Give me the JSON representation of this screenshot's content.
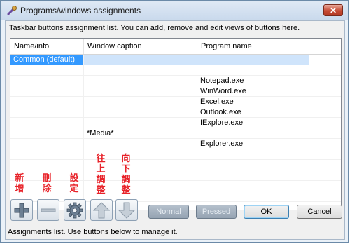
{
  "window": {
    "title": "Programs/windows assignments",
    "close_label": "✕"
  },
  "description": "Taskbar buttons assignment list. You can add, remove and edit views of buttons here.",
  "list": {
    "columns": [
      "Name/info",
      "Window caption",
      "Program name"
    ],
    "rows": [
      [
        "Common (default)",
        "",
        ""
      ],
      [
        "",
        "",
        ""
      ],
      [
        "",
        "",
        "Notepad.exe"
      ],
      [
        "",
        "",
        "WinWord.exe"
      ],
      [
        "",
        "",
        "Excel.exe"
      ],
      [
        "",
        "",
        "Outlook.exe"
      ],
      [
        "",
        "",
        "IExplore.exe"
      ],
      [
        "",
        "*Media*",
        ""
      ],
      [
        "",
        "",
        "Explorer.exe"
      ],
      [
        "",
        "",
        ""
      ],
      [
        "",
        "",
        ""
      ],
      [
        "",
        "",
        ""
      ],
      [
        "",
        "",
        ""
      ],
      [
        "",
        "",
        ""
      ]
    ]
  },
  "annotations": {
    "add": "新增",
    "remove": "刪除",
    "settings": "設定",
    "move_up": "往上調整",
    "move_down": "向下調整",
    "color": "#e8232a"
  },
  "toolbar": {
    "add_icon": "plus-icon",
    "remove_icon": "minus-icon",
    "settings_icon": "gear-icon",
    "up_icon": "arrow-up-icon",
    "down_icon": "arrow-down-icon"
  },
  "buttons": {
    "normal": "Normal",
    "pressed": "Pressed",
    "ok": "OK",
    "cancel": "Cancel"
  },
  "status": "Assignments list. Use buttons below to manage it."
}
